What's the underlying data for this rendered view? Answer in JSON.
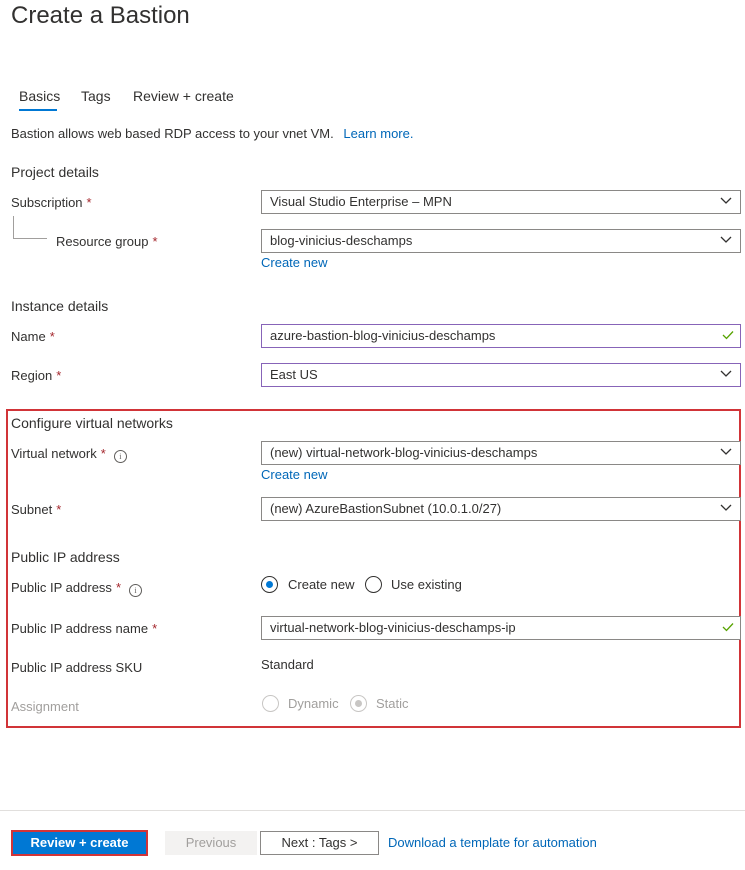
{
  "page": {
    "title": "Create a Bastion"
  },
  "tabs": [
    {
      "label": "Basics",
      "active": true
    },
    {
      "label": "Tags",
      "active": false
    },
    {
      "label": "Review + create",
      "active": false
    }
  ],
  "description": {
    "text": "Bastion allows web based RDP access to your vnet VM.",
    "link": "Learn more."
  },
  "project": {
    "heading": "Project details",
    "subscription_label": "Subscription",
    "subscription_value": "Visual Studio Enterprise – MPN",
    "resource_group_label": "Resource group",
    "resource_group_value": "blog-vinicius-deschamps",
    "create_new": "Create new"
  },
  "instance": {
    "heading": "Instance details",
    "name_label": "Name",
    "name_value": "azure-bastion-blog-vinicius-deschamps",
    "region_label": "Region",
    "region_value": "East US"
  },
  "vnet": {
    "heading": "Configure virtual networks",
    "vnet_label": "Virtual network",
    "vnet_value": "(new) virtual-network-blog-vinicius-deschamps",
    "create_new": "Create new",
    "subnet_label": "Subnet",
    "subnet_value": "(new) AzureBastionSubnet (10.0.1.0/27)"
  },
  "publicip": {
    "heading": "Public IP address",
    "ip_label": "Public IP address",
    "option_create": "Create new",
    "option_existing": "Use existing",
    "selected": "Create new",
    "name_label": "Public IP address name",
    "name_value": "virtual-network-blog-vinicius-deschamps-ip",
    "sku_label": "Public IP address SKU",
    "sku_value": "Standard",
    "assignment_label": "Assignment",
    "option_dynamic": "Dynamic",
    "option_static": "Static",
    "assignment_selected": "Static"
  },
  "required_mark": "*",
  "info_glyph": "i",
  "footer": {
    "review_create": "Review + create",
    "previous": "Previous",
    "next": "Next : Tags >",
    "download": "Download a template for automation"
  },
  "colors": {
    "accent": "#0078d4",
    "highlight": "#d13438",
    "valid_border": "#8764b8",
    "required": "#a4262c"
  },
  "icons": {
    "dropdown": "chevron-down-icon",
    "valid": "checkmark-icon",
    "info": "info-icon"
  }
}
